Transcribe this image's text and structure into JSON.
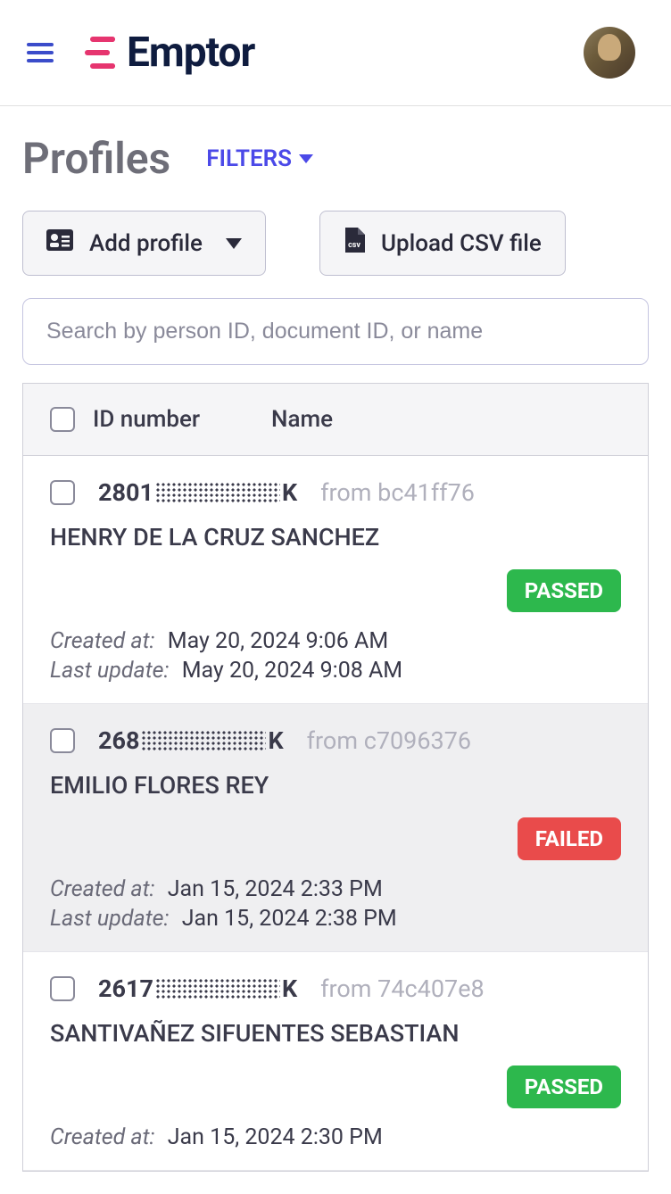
{
  "header": {
    "brand": "Emptor"
  },
  "page": {
    "title": "Profiles",
    "filters_label": "FILTERS"
  },
  "actions": {
    "add_profile": "Add profile",
    "upload_csv": "Upload CSV file"
  },
  "search": {
    "placeholder": "Search by person ID, document ID, or name"
  },
  "table": {
    "header_id": "ID number",
    "header_name": "Name"
  },
  "labels": {
    "created_at": "Created at:",
    "last_update": "Last update:",
    "from_prefix": "from"
  },
  "rows": [
    {
      "id_prefix": "2801",
      "id_suffix": "K",
      "from": "bc41ff76",
      "name": "HENRY DE LA CRUZ SANCHEZ",
      "status": "PASSED",
      "status_class": "passed",
      "created_at": "May 20, 2024 9:06 AM",
      "last_update": "May 20, 2024 9:08 AM",
      "alt": false
    },
    {
      "id_prefix": "268",
      "id_suffix": "K",
      "from": "c7096376",
      "name": "EMILIO FLORES REY",
      "status": "FAILED",
      "status_class": "failed",
      "created_at": "Jan 15, 2024 2:33 PM",
      "last_update": "Jan 15, 2024 2:38 PM",
      "alt": true
    },
    {
      "id_prefix": "2617",
      "id_suffix": "K",
      "from": "74c407e8",
      "name": "SANTIVAÑEZ SIFUENTES SEBASTIAN",
      "status": "PASSED",
      "status_class": "passed",
      "created_at": "Jan 15, 2024 2:30 PM",
      "last_update": "",
      "alt": false
    }
  ]
}
